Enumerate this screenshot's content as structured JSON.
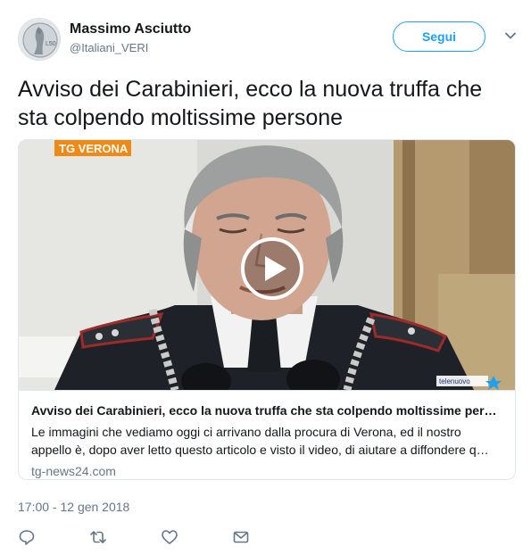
{
  "author": {
    "name": "Massimo Asciutto",
    "handle": "@Italiani_VERI",
    "avatar_icon": "coin-avatar-icon",
    "avatar_text": "L50"
  },
  "follow_button": {
    "label": "Segui"
  },
  "menu_icon": "chevron-down-icon",
  "tweet": {
    "text": "Avviso dei Carabinieri, ecco la nuova truffa che sta colpendo moltissime persone"
  },
  "card": {
    "channel_badge": "TG VERONA",
    "watermark": "telenuovo",
    "title": "Avviso dei Carabinieri, ecco la nuova truffa che sta colpendo moltissime pers…",
    "description": "Le immagini che vediamo oggi ci arrivano dalla procura di Verona, ed il nostro appello è, dopo aver letto questo articolo e visto il video, di aiutare a diffondere q…",
    "domain": "tg-news24.com",
    "play_icon": "play-icon"
  },
  "timestamp": "17:00 - 12 gen 2018",
  "actions": [
    "reply-icon",
    "retweet-icon",
    "like-icon",
    "message-icon"
  ],
  "colors": {
    "accent": "#1da1f2",
    "muted": "#657786",
    "text": "#14171a",
    "border": "#e1e8ed"
  }
}
